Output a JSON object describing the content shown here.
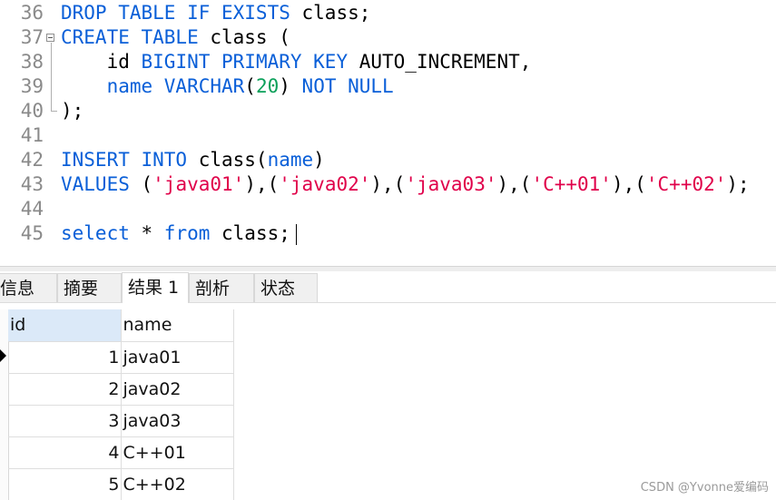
{
  "editor": {
    "lines": [
      {
        "num": "36",
        "tokens": [
          {
            "t": "DROP TABLE IF EXISTS",
            "c": "kw"
          },
          {
            "t": " class;",
            "c": "plain"
          }
        ]
      },
      {
        "num": "37",
        "tokens": [
          {
            "t": "CREATE TABLE",
            "c": "kw"
          },
          {
            "t": " class (",
            "c": "plain"
          }
        ]
      },
      {
        "num": "38",
        "tokens": [
          {
            "t": "    id ",
            "c": "plain"
          },
          {
            "t": "BIGINT PRIMARY KEY",
            "c": "kw"
          },
          {
            "t": " AUTO_INCREMENT,",
            "c": "plain"
          }
        ]
      },
      {
        "num": "39",
        "tokens": [
          {
            "t": "    ",
            "c": "plain"
          },
          {
            "t": "name VARCHAR",
            "c": "kw"
          },
          {
            "t": "(",
            "c": "plain"
          },
          {
            "t": "20",
            "c": "num"
          },
          {
            "t": ") ",
            "c": "plain"
          },
          {
            "t": "NOT NULL",
            "c": "kw"
          }
        ]
      },
      {
        "num": "40",
        "tokens": [
          {
            "t": ");",
            "c": "plain"
          }
        ]
      },
      {
        "num": "41",
        "tokens": []
      },
      {
        "num": "42",
        "tokens": [
          {
            "t": "INSERT INTO",
            "c": "kw"
          },
          {
            "t": " class(",
            "c": "plain"
          },
          {
            "t": "name",
            "c": "kw"
          },
          {
            "t": ")",
            "c": "plain"
          }
        ]
      },
      {
        "num": "43",
        "tokens": [
          {
            "t": "VALUES",
            "c": "kw"
          },
          {
            "t": " (",
            "c": "plain"
          },
          {
            "t": "'java01'",
            "c": "str"
          },
          {
            "t": "),(",
            "c": "plain"
          },
          {
            "t": "'java02'",
            "c": "str"
          },
          {
            "t": "),(",
            "c": "plain"
          },
          {
            "t": "'java03'",
            "c": "str"
          },
          {
            "t": "),(",
            "c": "plain"
          },
          {
            "t": "'C++01'",
            "c": "str"
          },
          {
            "t": "),(",
            "c": "plain"
          },
          {
            "t": "'C++02'",
            "c": "str"
          },
          {
            "t": ");",
            "c": "plain"
          }
        ]
      },
      {
        "num": "44",
        "tokens": []
      },
      {
        "num": "45",
        "tokens": [
          {
            "t": "select",
            "c": "kw"
          },
          {
            "t": " * ",
            "c": "plain"
          },
          {
            "t": "from",
            "c": "kw"
          },
          {
            "t": " class;",
            "c": "plain"
          }
        ]
      }
    ]
  },
  "tabs": [
    {
      "label": "信息",
      "name": "tab-info",
      "active": false
    },
    {
      "label": "摘要",
      "name": "tab-summary",
      "active": false
    },
    {
      "label": "结果 1",
      "name": "tab-result-1",
      "active": true
    },
    {
      "label": "剖析",
      "name": "tab-profile",
      "active": false
    },
    {
      "label": "状态",
      "name": "tab-status",
      "active": false
    }
  ],
  "result": {
    "columns": [
      "id",
      "name"
    ],
    "rows": [
      {
        "id": "1",
        "name": "java01"
      },
      {
        "id": "2",
        "name": "java02"
      },
      {
        "id": "3",
        "name": "java03"
      },
      {
        "id": "4",
        "name": "C++01"
      },
      {
        "id": "5",
        "name": "C++02"
      }
    ]
  },
  "colors": {
    "keyword": "#0a5fd8",
    "number": "#0aa05a",
    "string": "#e0004a",
    "selected_header": "#dbe9f8"
  },
  "icons": {
    "fold": "fold-collapse-icon",
    "row_pointer": "current-row-pointer-icon"
  },
  "watermark": "CSDN @Yvonne爱编码"
}
